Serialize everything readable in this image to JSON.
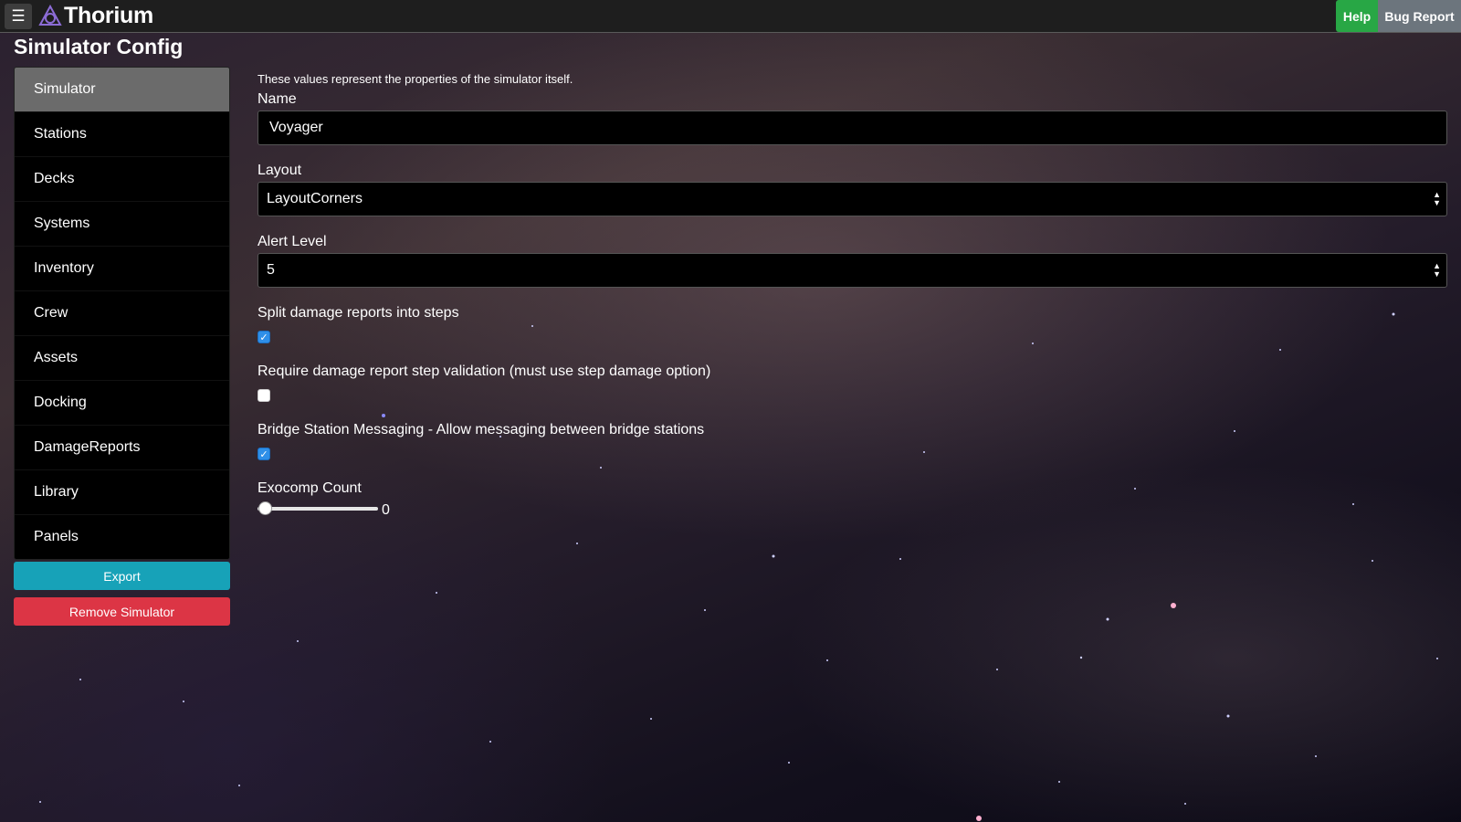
{
  "app": {
    "name": "Thorium",
    "menu_icon": "hamburger-icon",
    "logo_icon": "thorium-logo-icon",
    "help_label": "Help",
    "bug_report_label": "Bug Report",
    "accent": "#28a745"
  },
  "page": {
    "title": "Simulator Config"
  },
  "sidebar": {
    "items": [
      {
        "label": "Simulator",
        "active": true
      },
      {
        "label": "Stations",
        "active": false
      },
      {
        "label": "Decks",
        "active": false
      },
      {
        "label": "Systems",
        "active": false
      },
      {
        "label": "Inventory",
        "active": false
      },
      {
        "label": "Crew",
        "active": false
      },
      {
        "label": "Assets",
        "active": false
      },
      {
        "label": "Docking",
        "active": false
      },
      {
        "label": "DamageReports",
        "active": false
      },
      {
        "label": "Library",
        "active": false
      },
      {
        "label": "Panels",
        "active": false
      }
    ],
    "export_label": "Export",
    "remove_label": "Remove Simulator",
    "export_color": "#17a2b8",
    "remove_color": "#dc3545"
  },
  "form": {
    "description": "These values represent the properties of the simulator itself.",
    "name": {
      "label": "Name",
      "value": "Voyager"
    },
    "layout": {
      "label": "Layout",
      "value": "LayoutCorners"
    },
    "alert_level": {
      "label": "Alert Level",
      "value": "5"
    },
    "split_damage": {
      "label": "Split damage reports into steps",
      "checked": true
    },
    "require_validation": {
      "label": "Require damage report step validation (must use step damage option)",
      "checked": false
    },
    "bridge_messaging": {
      "label": "Bridge Station Messaging - Allow messaging between bridge stations",
      "checked": true
    },
    "exocomp": {
      "label": "Exocomp Count",
      "value": "0"
    }
  }
}
